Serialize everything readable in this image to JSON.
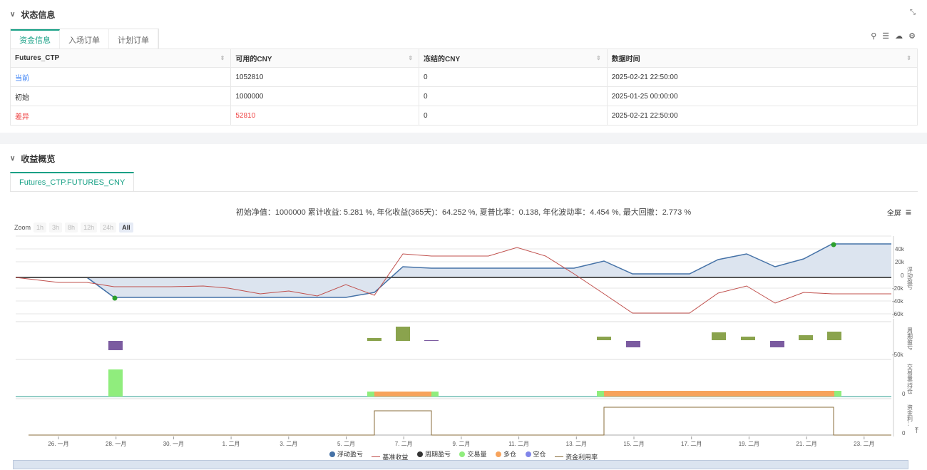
{
  "status_section": {
    "title": "状态信息",
    "tabs": [
      "资金信息",
      "入场订单",
      "计划订单"
    ],
    "columns": [
      "Futures_CTP",
      "可用的CNY",
      "冻结的CNY",
      "数据时间"
    ],
    "rows": [
      [
        "当前",
        "1052810",
        "0",
        "2025-02-21 22:50:00"
      ],
      [
        "初始",
        "1000000",
        "0",
        "2025-01-25 00:00:00"
      ],
      [
        "差异",
        "52810",
        "0",
        "2025-02-21 22:50:00"
      ]
    ]
  },
  "profit_section": {
    "title": "收益概览",
    "tab": "Futures_CTP.FUTURES_CNY",
    "summary": "初始净值：1000000 累计收益: 5.281 %, 年化收益(365天)：64.252 %, 夏普比率：0.138, 年化波动率：4.454 %, 最大回撤：2.773 %",
    "fullscreen": "全屏",
    "zoom_label": "Zoom",
    "zoom_options": [
      "1h",
      "3h",
      "8h",
      "12h",
      "24h",
      "All"
    ]
  },
  "chart_data": {
    "type": "line",
    "x_ticks": [
      "26. 一月",
      "28. 一月",
      "30. 一月",
      "1. 二月",
      "3. 二月",
      "5. 二月",
      "7. 二月",
      "9. 二月",
      "11. 二月",
      "13. 二月",
      "15. 二月",
      "17. 二月",
      "19. 二月",
      "21. 二月",
      "23. 二月"
    ],
    "y1_ticks": [
      "40k",
      "20k",
      "0",
      "-20k",
      "-40k",
      "-60k"
    ],
    "pane_labels": [
      "浮动盈亏",
      "周期盈亏",
      "交易量/持仓",
      "资金利..."
    ],
    "y2_tick": "-50k",
    "y3_tick": "0",
    "y4_tick": "0",
    "series": [
      {
        "name": "浮动盈亏",
        "color": "#4572a7"
      },
      {
        "name": "基准收益",
        "color": "#c0504d"
      },
      {
        "name": "周期盈亏",
        "color": "#333333"
      },
      {
        "name": "交易量",
        "color": "#90ed7d"
      },
      {
        "name": "多仓",
        "color": "#f7a35c"
      },
      {
        "name": "空仓",
        "color": "#8085e9"
      },
      {
        "name": "资金利用率",
        "color": "#8a6d3b"
      }
    ]
  }
}
